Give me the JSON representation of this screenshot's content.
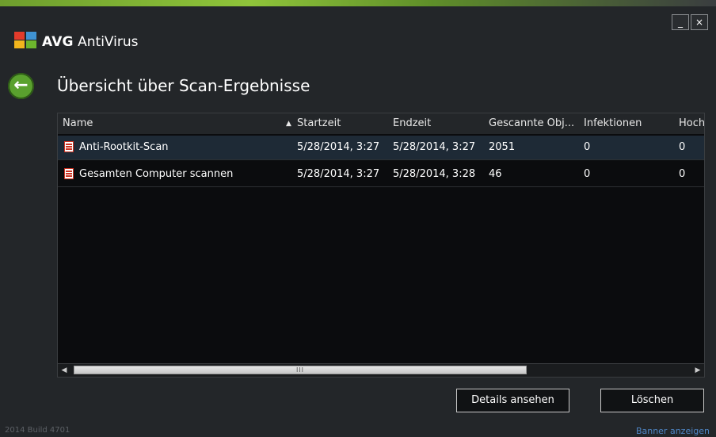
{
  "app": {
    "brand_bold": "AVG",
    "brand_name": "AntiVirus"
  },
  "window_controls": {
    "minimize": "_",
    "close": "×"
  },
  "page": {
    "title": "Übersicht über Scan-Ergebnisse",
    "back_icon": "back-arrow-icon"
  },
  "table": {
    "columns": [
      "Name",
      "Startzeit",
      "Endzeit",
      "Gescannte Obj...",
      "Infektionen",
      "Hoch"
    ],
    "sort_column": "Startzeit",
    "sort_indicator": "▲",
    "rows": [
      {
        "name": "Anti-Rootkit-Scan",
        "start": "5/28/2014, 3:27",
        "end": "5/28/2014, 3:27",
        "scanned": "2051",
        "infections": "0",
        "high": "0",
        "selected": true
      },
      {
        "name": "Gesamten Computer scannen",
        "start": "5/28/2014, 3:27",
        "end": "5/28/2014, 3:28",
        "scanned": "46",
        "infections": "0",
        "high": "0",
        "selected": false
      }
    ],
    "scroll_left": "◀",
    "scroll_right": "▶",
    "scroll_grip": "III"
  },
  "buttons": {
    "details": "Details ansehen",
    "delete": "Löschen"
  },
  "footer": {
    "build": "2014  Build 4701",
    "banner_link": "Banner anzeigen"
  },
  "colors": {
    "accent_green": "#5aa12e",
    "selection": "#1e2a36",
    "link": "#4f86c6"
  }
}
